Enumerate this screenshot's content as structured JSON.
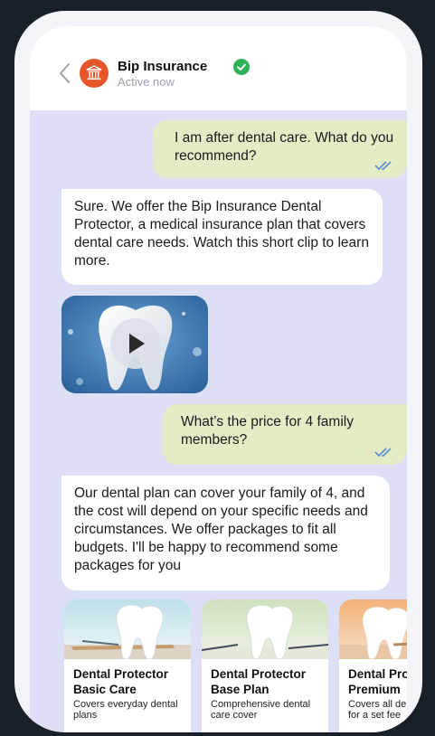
{
  "header": {
    "title": "Bip Insurance",
    "status": "Active now"
  },
  "messages": [
    {
      "from": "user",
      "text": "I am after dental care. What do you recommend?"
    },
    {
      "from": "bot",
      "text": "Sure. We offer the Bip Insurance Dental Protector, a medical insurance plan that covers dental care needs. Watch this short clip to learn more."
    },
    {
      "from": "user",
      "text": "What’s the price for 4 family members?"
    },
    {
      "from": "bot",
      "text": "Our dental plan can cover your family of 4, and the cost will depend on your specific needs and circumstances. We offer packages to fit all budgets. I'll be happy to recommend some packages for you"
    }
  ],
  "cards": [
    {
      "title": "Dental Protector Basic Care",
      "desc": "Covers everyday dental plans"
    },
    {
      "title": "Dental Protector Base Plan",
      "desc": "Comprehensive dental care cover"
    },
    {
      "title": "Dental Protector Premium",
      "desc": "Covers all dental costs for a set fee"
    }
  ],
  "colors": {
    "brand": "#e7542a",
    "verified": "#2fb15a",
    "outgoing_bubble": "#e2ecc5",
    "read_ticks": "#5b8fd0"
  }
}
